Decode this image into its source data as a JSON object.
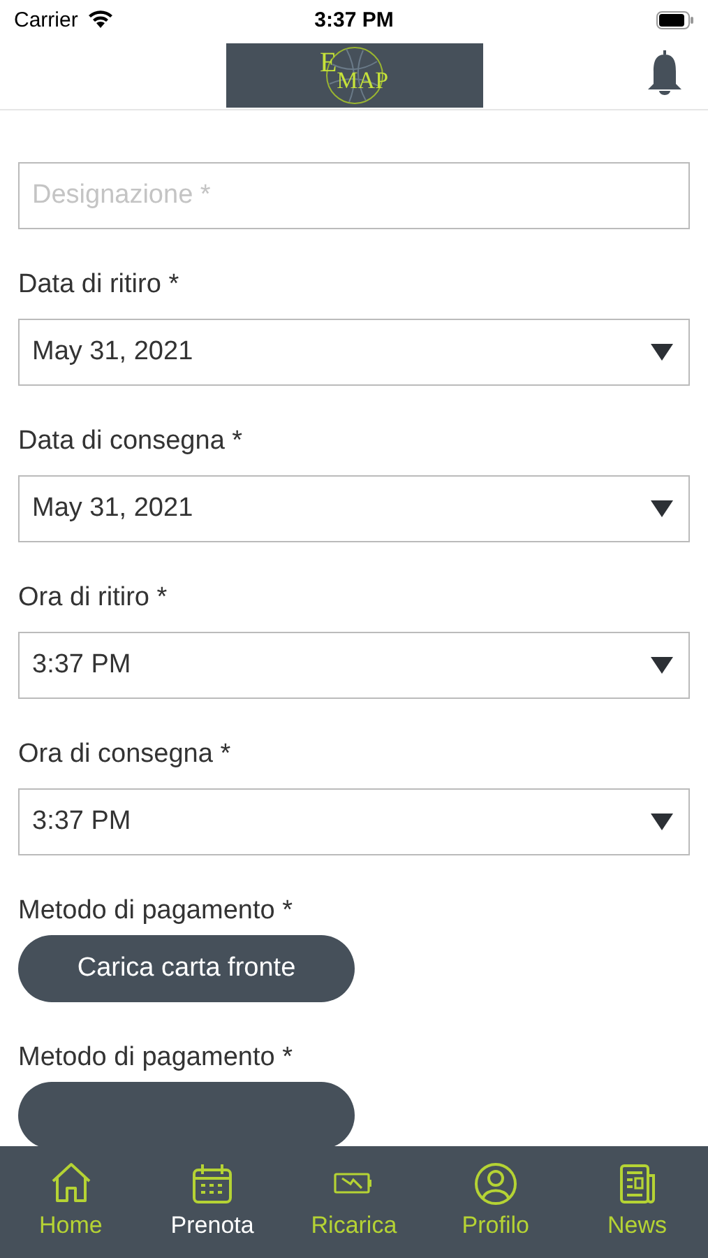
{
  "status_bar": {
    "carrier": "Carrier",
    "time": "3:37 PM"
  },
  "header": {
    "logo": {
      "letter": "E",
      "word": "MAP"
    }
  },
  "form": [
    {
      "kind": "text",
      "placeholder": "Designazione *"
    },
    {
      "kind": "select",
      "label": "Data di ritiro *",
      "value": "May 31, 2021"
    },
    {
      "kind": "select",
      "label": "Data di consegna *",
      "value": "May 31, 2021"
    },
    {
      "kind": "select",
      "label": "Ora di ritiro *",
      "value": "3:37 PM"
    },
    {
      "kind": "select",
      "label": "Ora di consegna *",
      "value": "3:37 PM"
    },
    {
      "kind": "button",
      "label": "Metodo di pagamento *",
      "button": "Carica carta fronte"
    },
    {
      "kind": "button",
      "label": "Metodo di pagamento *"
    }
  ],
  "tab_bar": [
    {
      "kind": "home",
      "label": "Home",
      "selected": false
    },
    {
      "kind": "calendar",
      "label": "Prenota",
      "selected": true
    },
    {
      "kind": "battery",
      "label": "Ricarica",
      "selected": false
    },
    {
      "kind": "profile",
      "label": "Profilo",
      "selected": false
    },
    {
      "kind": "news",
      "label": "News",
      "selected": false
    }
  ]
}
